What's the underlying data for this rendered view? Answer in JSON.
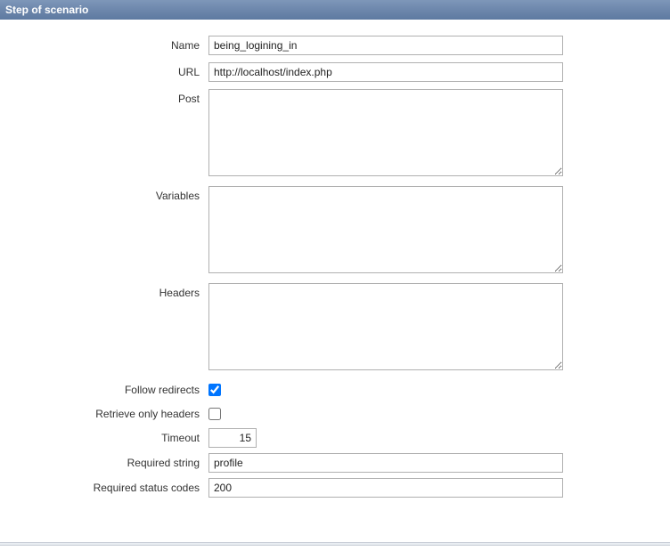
{
  "header": {
    "title": "Step of scenario"
  },
  "form": {
    "name": {
      "label": "Name",
      "value": "being_logining_in"
    },
    "url": {
      "label": "URL",
      "value": "http://localhost/index.php"
    },
    "post": {
      "label": "Post",
      "value": ""
    },
    "variables": {
      "label": "Variables",
      "value": ""
    },
    "headers": {
      "label": "Headers",
      "value": ""
    },
    "follow_redirects": {
      "label": "Follow redirects",
      "checked": true
    },
    "retrieve_only_headers": {
      "label": "Retrieve only headers",
      "checked": false
    },
    "timeout": {
      "label": "Timeout",
      "value": "15"
    },
    "required_string": {
      "label": "Required string",
      "value": "profile"
    },
    "required_status": {
      "label": "Required status codes",
      "value": "200"
    }
  }
}
